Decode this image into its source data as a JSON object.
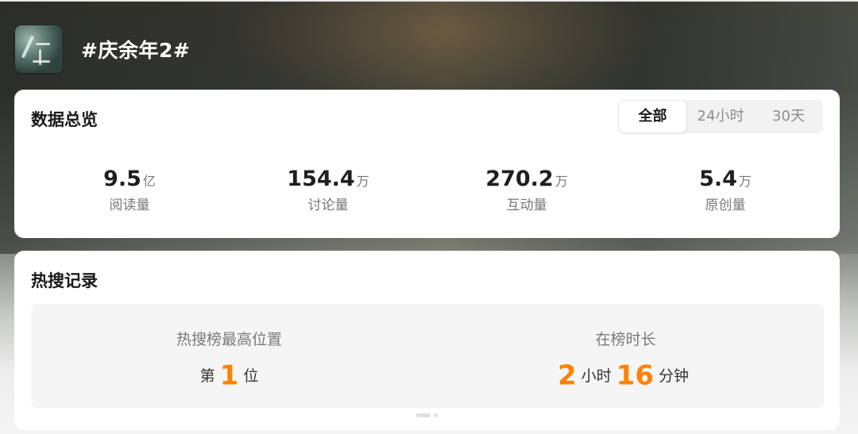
{
  "header": {
    "cover_icon": "topic-cover-image",
    "title": "#庆余年2#"
  },
  "overview": {
    "title": "数据总览",
    "tabs": [
      {
        "label": "全部",
        "active": true
      },
      {
        "label": "24小时",
        "active": false
      },
      {
        "label": "30天",
        "active": false
      }
    ],
    "stats": [
      {
        "value": "9.5",
        "unit": "亿",
        "label": "阅读量"
      },
      {
        "value": "154.4",
        "unit": "万",
        "label": "讨论量"
      },
      {
        "value": "270.2",
        "unit": "万",
        "label": "互动量"
      },
      {
        "value": "5.4",
        "unit": "万",
        "label": "原创量"
      }
    ]
  },
  "hot_record": {
    "title": "热搜记录",
    "highest_position": {
      "label": "热搜榜最高位置",
      "prefix": "第",
      "number": "1",
      "suffix": "位"
    },
    "duration": {
      "label": "在榜时长",
      "hours": "2",
      "hours_unit": "小时",
      "minutes": "16",
      "minutes_unit": "分钟"
    }
  },
  "pager": {
    "pages": 2,
    "current": 1
  },
  "colors": {
    "accent_orange": "#ff8200",
    "card_bg": "#ffffff",
    "panel_bg": "#f5f5f5"
  }
}
